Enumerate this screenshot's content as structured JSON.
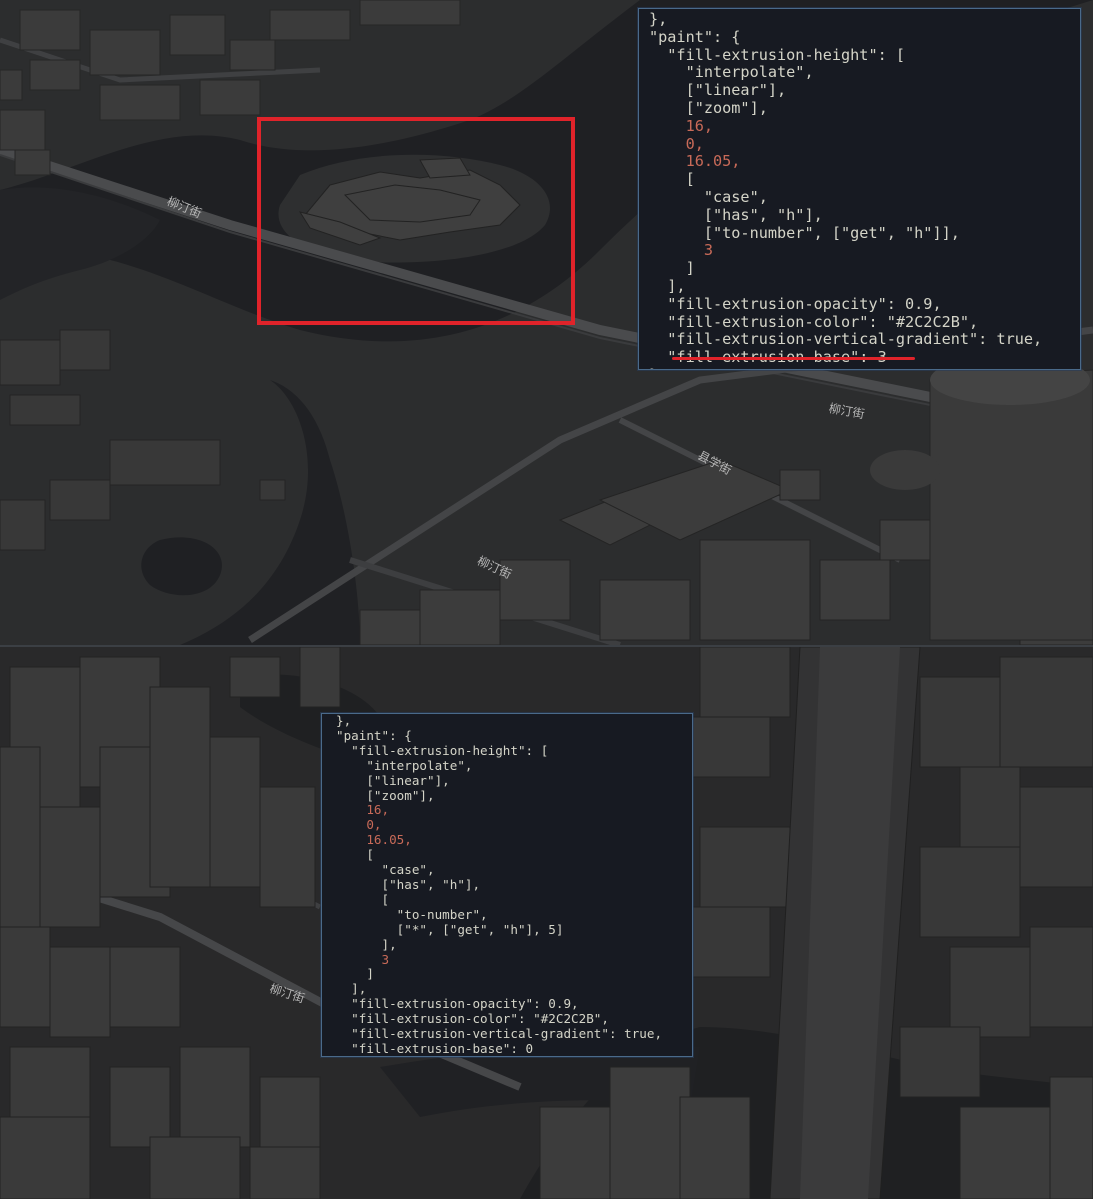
{
  "top": {
    "road_labels": [
      "柳汀街",
      "柳汀街",
      "县学街",
      "柳汀街"
    ],
    "code_lines": [
      "},",
      "\"paint\": {",
      "  \"fill-extrusion-height\": [",
      "    \"interpolate\",",
      "    [\"linear\"],",
      "    [\"zoom\"],",
      "    16,",
      "    0,",
      "    16.05,",
      "    [",
      "      \"case\",",
      "      [\"has\", \"h\"],",
      "      [\"to-number\", [\"get\", \"h\"]],",
      "      3",
      "    ]",
      "  ],",
      "  \"fill-extrusion-opacity\": 0.9,",
      "  \"fill-extrusion-color\": \"#2C2C2B\",",
      "  \"fill-extrusion-vertical-gradient\": true,",
      "  \"fill-extrusion-base\": 3",
      "},"
    ]
  },
  "bottom": {
    "road_labels": [
      "柳汀街"
    ],
    "code_lines": [
      "},",
      "\"paint\": {",
      "  \"fill-extrusion-height\": [",
      "    \"interpolate\",",
      "    [\"linear\"],",
      "    [\"zoom\"],",
      "    16,",
      "    0,",
      "    16.05,",
      "    [",
      "      \"case\",",
      "      [\"has\", \"h\"],",
      "      [",
      "        \"to-number\",",
      "        [\"*\", [\"get\", \"h\"], 5]",
      "      ],",
      "      3",
      "    ]",
      "  ],",
      "  \"fill-extrusion-opacity\": 0.9,",
      "  \"fill-extrusion-color\": \"#2C2C2B\",",
      "  \"fill-extrusion-vertical-gradient\": true,",
      "  \"fill-extrusion-base\": 0",
      "},"
    ]
  },
  "colors": {
    "highlight": "#e0232a",
    "number": "#c86a58",
    "code_text": "#d4d4c8",
    "code_bg": "#171a22",
    "water": "#1e1f22",
    "land": "#2c2d2e",
    "building": "#3a3a3a"
  }
}
